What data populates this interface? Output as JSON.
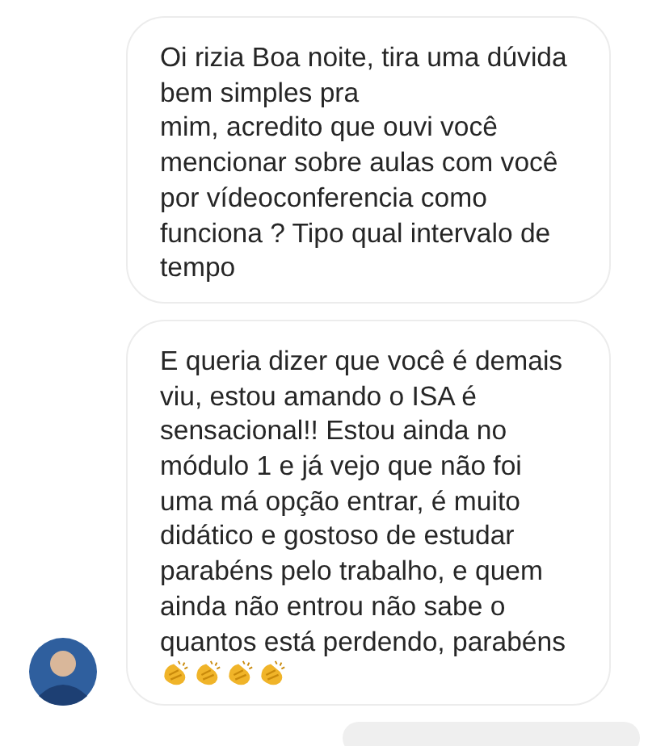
{
  "messages": [
    {
      "kind": "text",
      "text": "Oi rizia Boa noite, tira uma dúvida bem simples pra\nmim, acredito que ouvi você mencionar sobre aulas com você por vídeoconferencia como funciona ? Tipo qual intervalo de tempo",
      "avatar": false
    },
    {
      "kind": "text",
      "text": "E queria dizer que você é demais viu, estou amando o ISA é sensacional!! Estou ainda no módulo 1 e já vejo que não foi uma má opção entrar, é muito didático e gostoso de estudar parabéns pelo trabalho, e quem ainda não entrou não sabe o quantos está perdendo, parabéns",
      "avatar": true,
      "emojis": [
        {
          "kind": "clap"
        },
        {
          "kind": "clap"
        },
        {
          "kind": "clap"
        },
        {
          "kind": "clap"
        }
      ]
    },
    {
      "kind": "partial"
    }
  ]
}
